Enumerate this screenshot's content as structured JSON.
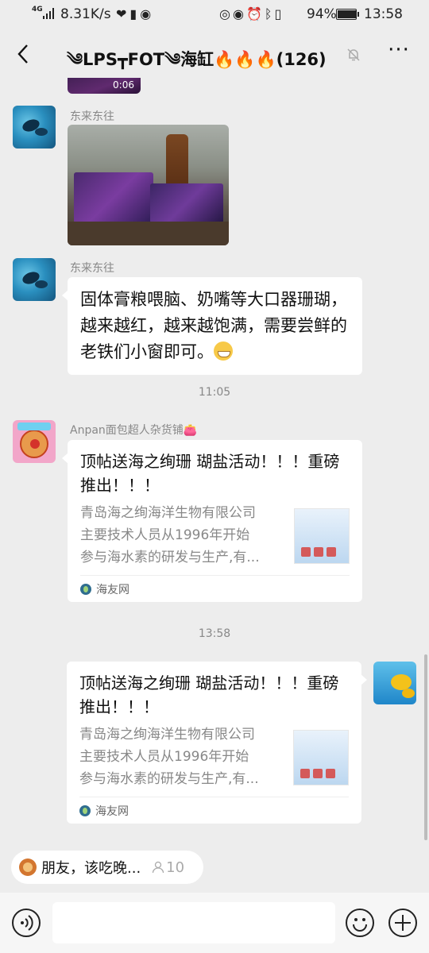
{
  "status_bar": {
    "network": "4G",
    "speed": "8.31K/s",
    "battery_percent": "94%",
    "battery_level": 0.94,
    "time": "13:58"
  },
  "header": {
    "title": "༄LPS┳FOT༄海缸🔥🔥🔥(126)",
    "icons": [
      "back-arrow-icon",
      "mute-bell-icon",
      "more-dots-icon"
    ]
  },
  "messages": {
    "video": {
      "duration": "0:06"
    },
    "photo_msg": {
      "sender": "东来东往"
    },
    "text_msg": {
      "sender": "东来东往",
      "text": "固体膏粮喂脑、奶嘴等大口器珊瑚，越来越红，越来越饱满，需要尝鲜的老铁们小窗即可。"
    },
    "time_1": "11:05",
    "link_msg_1": {
      "sender": "Anpan面包超人杂货铺👛",
      "title": "顶帖送海之绚珊 瑚盐活动！！！重磅推出！！！",
      "desc_lines": [
        "青岛海之绚海洋生物有限公司",
        "主要技术人员从1996年开始",
        "参与海水素的研发与生产,有..."
      ],
      "source": "海友网"
    },
    "time_2": "13:58",
    "link_msg_2": {
      "title": "顶帖送海之绚珊 瑚盐活动！！！重磅推出！！！",
      "desc_lines": [
        "青岛海之绚海洋生物有限公司",
        "主要技术人员从1996年开始",
        "参与海水素的研发与生产,有..."
      ],
      "source": "海友网"
    }
  },
  "notice": {
    "text": "朋友，该吃晚...",
    "count": "10"
  },
  "bottom_bar": {
    "icons": [
      "voice-icon",
      "emoji-icon",
      "plus-icon"
    ]
  }
}
